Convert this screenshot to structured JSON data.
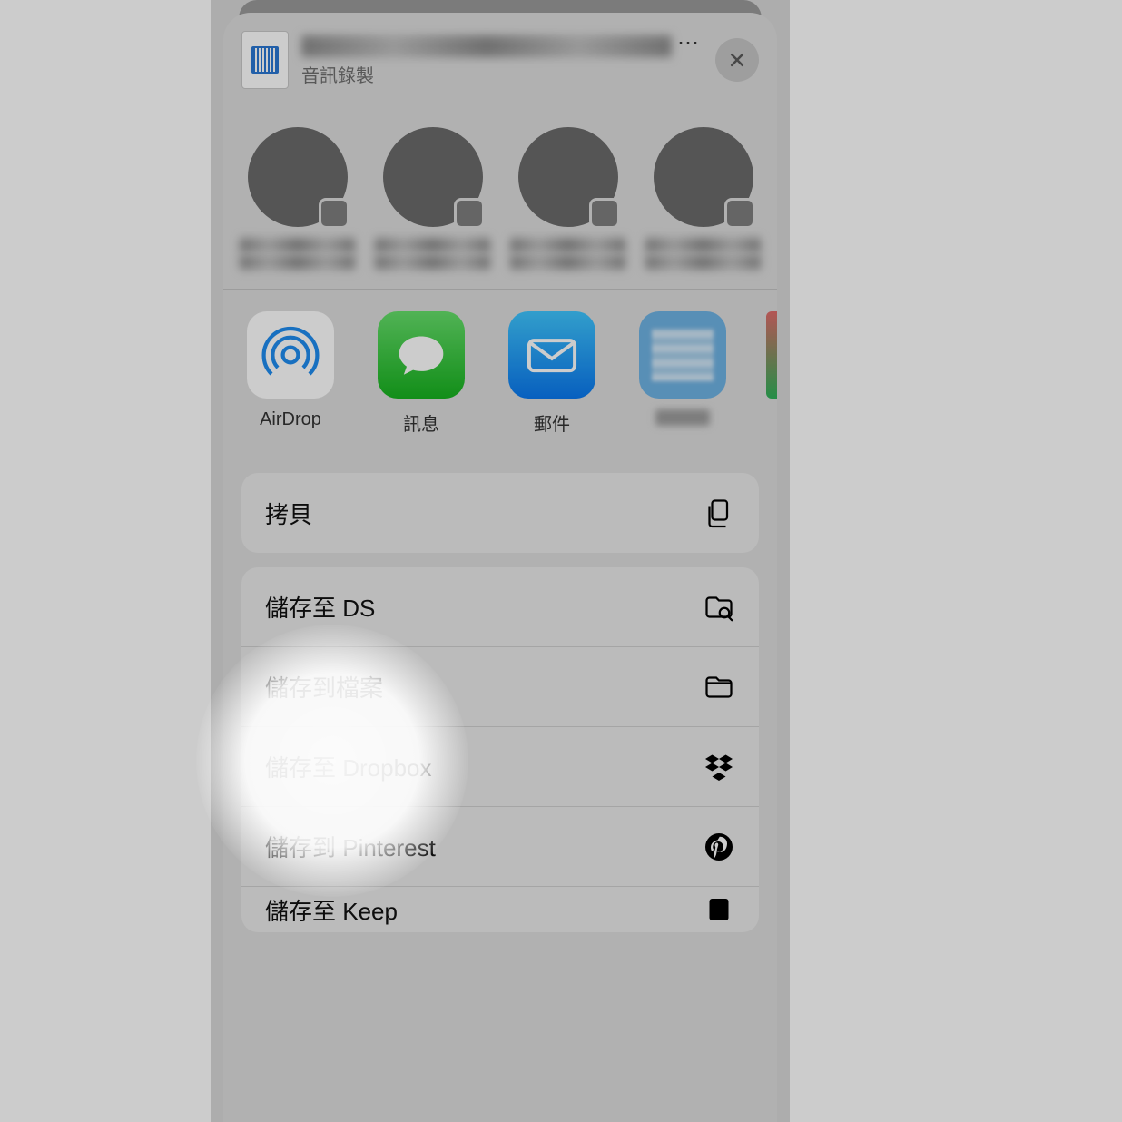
{
  "header": {
    "file_subtitle": "音訊錄製",
    "file_name_ellipsis": "⋯",
    "close_aria": "Close"
  },
  "apps": {
    "airdrop": "AirDrop",
    "messages": "訊息",
    "mail": "郵件"
  },
  "actions": {
    "copy": "拷貝",
    "save_ds": "儲存至 DS",
    "save_files": "儲存到檔案",
    "save_dropbox": "儲存至 Dropbox",
    "save_pinterest": "儲存到 Pinterest",
    "save_keep": "儲存至 Keep"
  },
  "icons": {
    "close": "close-icon",
    "copy": "copy-icon",
    "folder_search": "folder-search-icon",
    "folder": "folder-icon",
    "dropbox": "dropbox-icon",
    "pinterest": "pinterest-icon"
  }
}
